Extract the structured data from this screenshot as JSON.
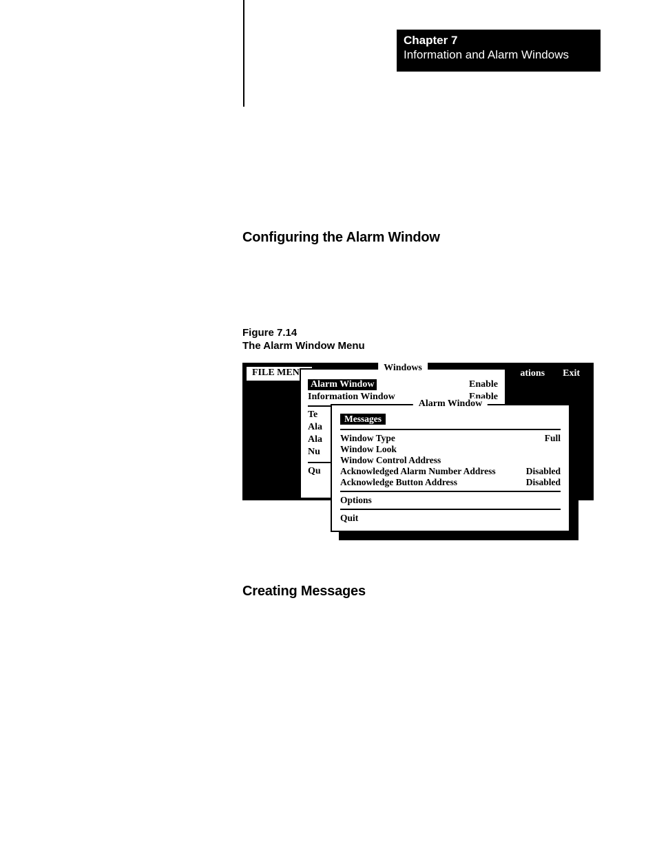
{
  "chapter": {
    "num": "Chapter 7",
    "title": "Information and Alarm Windows"
  },
  "headings": {
    "config": "Configuring the Alarm Window",
    "fig_num": "Figure 7.14",
    "fig_title": "The Alarm Window Menu",
    "creating": "Creating Messages"
  },
  "menubar": {
    "left": "FILE MENU",
    "right1": "ations",
    "right2": "Exit"
  },
  "windows_panel": {
    "title": "Windows",
    "rows": [
      {
        "label": "Alarm Window",
        "val": "Enable",
        "highlight": true
      },
      {
        "label": "Information Window",
        "val": "Enable"
      }
    ],
    "sub": {
      "r3": "Te",
      "r4": "Ala",
      "r5": "Ala",
      "r6": "Nu",
      "r7": "Qu"
    }
  },
  "alarm_panel": {
    "title": "Alarm Window",
    "rows": {
      "messages": "Messages",
      "wtype": {
        "l": "Window Type",
        "v": "Full"
      },
      "wlook": "Window Look",
      "wctrl": "Window Control Address",
      "ackna": {
        "l": "Acknowledged Alarm Number Address",
        "v": "Disabled"
      },
      "ackba": {
        "l": "Acknowledge Button Address",
        "v": "Disabled"
      },
      "options": "Options",
      "quit": "Quit"
    }
  }
}
